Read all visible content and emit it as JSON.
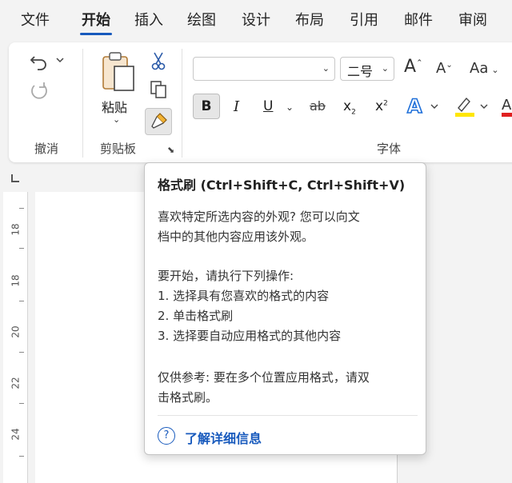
{
  "tabs": [
    {
      "label": "文件"
    },
    {
      "label": "开始"
    },
    {
      "label": "插入"
    },
    {
      "label": "绘图"
    },
    {
      "label": "设计"
    },
    {
      "label": "布局"
    },
    {
      "label": "引用"
    },
    {
      "label": "邮件"
    },
    {
      "label": "审阅"
    }
  ],
  "active_tab": "开始",
  "groups": {
    "undo": "撤消",
    "clipboard": "剪贴板",
    "font": "字体"
  },
  "clipboard": {
    "paste_label": "粘贴"
  },
  "font": {
    "font_name": "",
    "font_size": "二号",
    "change_case_label": "Aa",
    "bold": "B",
    "italic": "I",
    "underline": "U",
    "strikethrough": "ab",
    "subscript": "x",
    "superscript": "x"
  },
  "ruler": {
    "numbers": [
      "18",
      "18",
      "20",
      "22",
      "24"
    ]
  },
  "colors": {
    "accent": "#185abd",
    "highlight": "#ffe600",
    "font_color": "#e02020"
  },
  "tooltip": {
    "title": "格式刷 (Ctrl+Shift+C, Ctrl+Shift+V)",
    "lines": [
      "喜欢特定所选内容的外观? 您可以向文",
      "档中的其他内容应用该外观。",
      "要开始，请执行下列操作:",
      "1. 选择具有您喜欢的格式的内容",
      "2. 单击格式刷",
      "3. 选择要自动应用格式的其他内容",
      "仅供参考: 要在多个位置应用格式，请双",
      "击格式刷。"
    ],
    "link": "了解详细信息"
  }
}
